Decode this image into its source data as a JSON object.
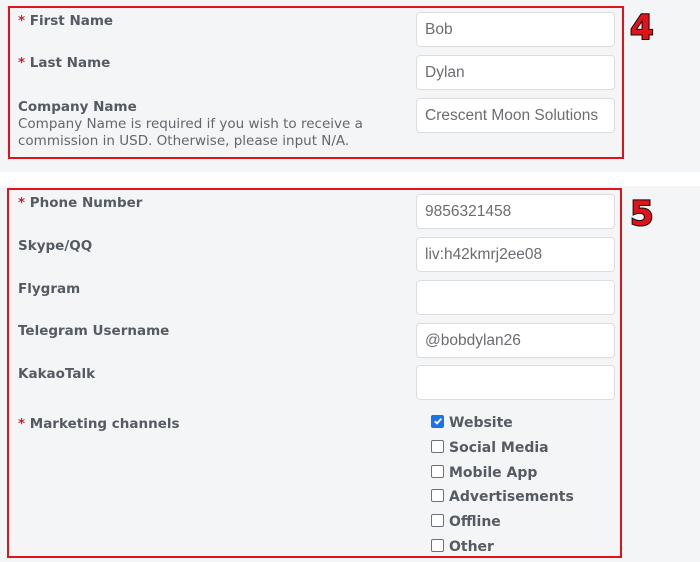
{
  "colors": {
    "outline": "#e0131b",
    "required_asterisk": "#c0262d",
    "panel_background": "#f4f5f7",
    "checkbox_checked": "#1a73e8"
  },
  "sections": [
    {
      "badge": "4",
      "fields": [
        {
          "label": "First Name",
          "required": true,
          "value": "Bob"
        },
        {
          "label": "Last Name",
          "required": true,
          "value": "Dylan"
        },
        {
          "label": "Company Name",
          "required": false,
          "help": "Company Name is required if you wish to receive a commission in USD. Otherwise, please input N/A.",
          "value": "Crescent Moon Solutions"
        }
      ]
    },
    {
      "badge": "5",
      "fields": [
        {
          "label": "Phone Number",
          "required": true,
          "value": "9856321458"
        },
        {
          "label": "Skype/QQ",
          "required": false,
          "value": "liv:h42kmrj2ee08"
        },
        {
          "label": "Flygram",
          "required": false,
          "value": ""
        },
        {
          "label": "Telegram Username",
          "required": false,
          "value": "@bobdylan26"
        },
        {
          "label": "KakaoTalk",
          "required": false,
          "value": ""
        }
      ],
      "marketing": {
        "label": "Marketing channels",
        "required": true,
        "options": [
          {
            "label": "Website",
            "checked": true
          },
          {
            "label": "Social Media",
            "checked": false
          },
          {
            "label": "Mobile App",
            "checked": false
          },
          {
            "label": "Advertisements",
            "checked": false
          },
          {
            "label": "Offline",
            "checked": false
          },
          {
            "label": "Other",
            "checked": false
          }
        ]
      }
    }
  ],
  "required_marker": "*"
}
